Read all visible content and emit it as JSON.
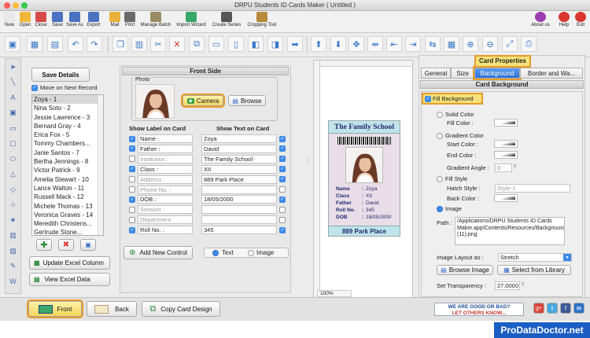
{
  "window": {
    "title": "DRPU Students ID Cards Maker ( Untitled )"
  },
  "menubar": {
    "items": [
      {
        "label": "New",
        "icon": "new-doc-icon",
        "color": "#e8e8e8"
      },
      {
        "label": "Open",
        "icon": "folder-icon",
        "color": "#f2b73a"
      },
      {
        "label": "Close",
        "icon": "close-doc-icon",
        "color": "#d84b4b"
      },
      {
        "label": "Save",
        "icon": "floppy-icon",
        "color": "#4a72c0"
      },
      {
        "label": "Save As",
        "icon": "floppy-as-icon",
        "color": "#4a72c0"
      },
      {
        "label": "Export",
        "icon": "export-icon",
        "color": "#4a72c0"
      },
      {
        "label": "Mail",
        "icon": "mail-icon",
        "color": "#e7b03a"
      },
      {
        "label": "Print",
        "icon": "printer-icon",
        "color": "#6a6a6a"
      },
      {
        "label": "Manage Batch",
        "icon": "batch-icon",
        "color": "#9a8c62"
      },
      {
        "label": "Import Wizard",
        "icon": "import-icon",
        "color": "#3aa86a"
      },
      {
        "label": "Create Series",
        "icon": "sigma-icon",
        "color": "#555555"
      },
      {
        "label": "Cropping Tool",
        "icon": "crop-icon",
        "color": "#b68a3a"
      }
    ],
    "right": [
      {
        "label": "About us",
        "icon": "info-icon",
        "color": "#9b3db0"
      },
      {
        "label": "Help",
        "icon": "help-icon",
        "color": "#d8372f"
      },
      {
        "label": "Exit",
        "icon": "exit-icon",
        "color": "#d8372f"
      }
    ]
  },
  "left": {
    "save_details": "Save Details",
    "move_next": "Move on Next Record",
    "records": [
      "Zoya - 1",
      "Nina Soto - 2",
      "Jessie Lawrence - 3",
      "Bernard Gray - 4",
      "Erica Fox - 5",
      "Tommy Chambers...",
      "Janie Santos - 7",
      "Bertha Jennings - 8",
      "Victor Patrick - 9",
      "Amelia Stewart - 10",
      "Lance Walton - 11",
      "Russell Mack - 12",
      "Michele Thomas - 13",
      "Veronica Graves - 14",
      "Meredith Christens...",
      "Gertrude Stone..."
    ],
    "update_excel": "Update Excel Column",
    "view_excel": "View Excel Data"
  },
  "front_side": {
    "header": "Front Side",
    "photo_label": "Photo",
    "camera": "Camera",
    "browse": "Browse",
    "show_label_header": "Show Label on Card",
    "show_text_header": "Show Text on Card",
    "rows": [
      {
        "label": "Name :",
        "value": "Zoya",
        "label_checked": true,
        "text_checked": true,
        "enabled": true
      },
      {
        "label": "Father :",
        "value": "David",
        "label_checked": true,
        "text_checked": true,
        "enabled": true
      },
      {
        "label": "Institution :",
        "value": "The Family School",
        "label_checked": false,
        "text_checked": true,
        "enabled": false
      },
      {
        "label": "Class :",
        "value": "XII",
        "label_checked": true,
        "text_checked": true,
        "enabled": true
      },
      {
        "label": "Address :",
        "value": "889 Park Place",
        "label_checked": false,
        "text_checked": true,
        "enabled": false
      },
      {
        "label": "Phone No. :",
        "value": "",
        "label_checked": false,
        "text_checked": false,
        "enabled": false
      },
      {
        "label": "DOB :",
        "value": "18/05/2000",
        "label_checked": true,
        "text_checked": true,
        "enabled": true
      },
      {
        "label": "Session :",
        "value": "",
        "label_checked": false,
        "text_checked": false,
        "enabled": false
      },
      {
        "label": "Department :",
        "value": "",
        "label_checked": false,
        "text_checked": false,
        "enabled": false
      },
      {
        "label": "Roll No. :",
        "value": "345",
        "label_checked": true,
        "text_checked": true,
        "enabled": true
      }
    ],
    "add_control": "Add New Control",
    "text_option": "Text",
    "image_option": "Image"
  },
  "card": {
    "school": "The Family School",
    "fields": [
      {
        "k": "Name",
        "v": "Zoya"
      },
      {
        "k": "Class",
        "v": "XII"
      },
      {
        "k": "Father",
        "v": "David"
      },
      {
        "k": "Roll No.",
        "v": "345"
      },
      {
        "k": "DOB",
        "v": "18/05/2000"
      }
    ],
    "address": "889 Park Place",
    "zoom": "100%"
  },
  "properties": {
    "title": "Card Properties",
    "tabs": [
      "General",
      "Size",
      "Background",
      "Border and Wa..."
    ],
    "section": "Card Background",
    "fill_background": "Fill Background",
    "solid_color": "Solid Color",
    "fill_color": "Fill Color :",
    "gradient_color": "Gradient Color",
    "start_color": "Start Color :",
    "end_color": "End Color :",
    "gradient_angle": "Gradient Angle :",
    "gradient_angle_value": "0",
    "fill_style": "Fill Style",
    "hatch_style": "Hatch Style :",
    "hatch_value": "Style-1",
    "back_color": "Back Color :",
    "image": "Image",
    "path_label": "Path :",
    "path_value": "/Applications/DRPU Students ID Cards Maker.app/Contents/Resources/Background/m_bg (11).png",
    "layout_label": "Image Layout as :",
    "layout_value": "Stretch",
    "browse_image": "Browse Image",
    "select_library": "Select from Library",
    "transparency_label": "Set Transparency :",
    "transparency_value": "27.0000"
  },
  "bottom": {
    "front": "Front",
    "back": "Back",
    "copy": "Copy Card Design",
    "feedback_line1": "WE ARE GOOD OR BAD?",
    "feedback_line2": "LET OTHERS KNOW...",
    "brand": "ProDataDoctor.net"
  }
}
